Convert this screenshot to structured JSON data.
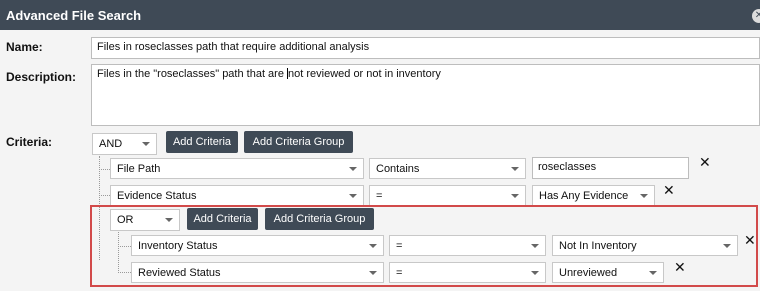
{
  "dialog": {
    "title": "Advanced File Search",
    "close_glyph": "✕",
    "accent_color": "#3f4a56",
    "highlight_color": "#d24a4a"
  },
  "form": {
    "name_label": "Name:",
    "name_value": "Files in roseclasses path that require additional analysis",
    "description_label": "Description:",
    "description_before_caret": "Files in the \"roseclasses\" path that are ",
    "description_after_caret": "not reviewed or not in inventory",
    "criteria_label": "Criteria:"
  },
  "root_group": {
    "operator": "AND",
    "add_criteria_label": "Add Criteria",
    "add_group_label": "Add Criteria Group",
    "rows": [
      {
        "field": "File Path",
        "op": "Contains",
        "value": "roseclasses",
        "remove": "✕"
      },
      {
        "field": "Evidence Status",
        "op": "=",
        "value": "Has Any Evidence",
        "remove": "✕"
      }
    ]
  },
  "sub_group": {
    "operator": "OR",
    "add_criteria_label": "Add Criteria",
    "add_group_label": "Add Criteria Group",
    "rows": [
      {
        "field": "Inventory Status",
        "op": "=",
        "value": "Not In Inventory",
        "remove": "✕"
      },
      {
        "field": "Reviewed Status",
        "op": "=",
        "value": "Unreviewed",
        "remove": "✕"
      }
    ]
  }
}
